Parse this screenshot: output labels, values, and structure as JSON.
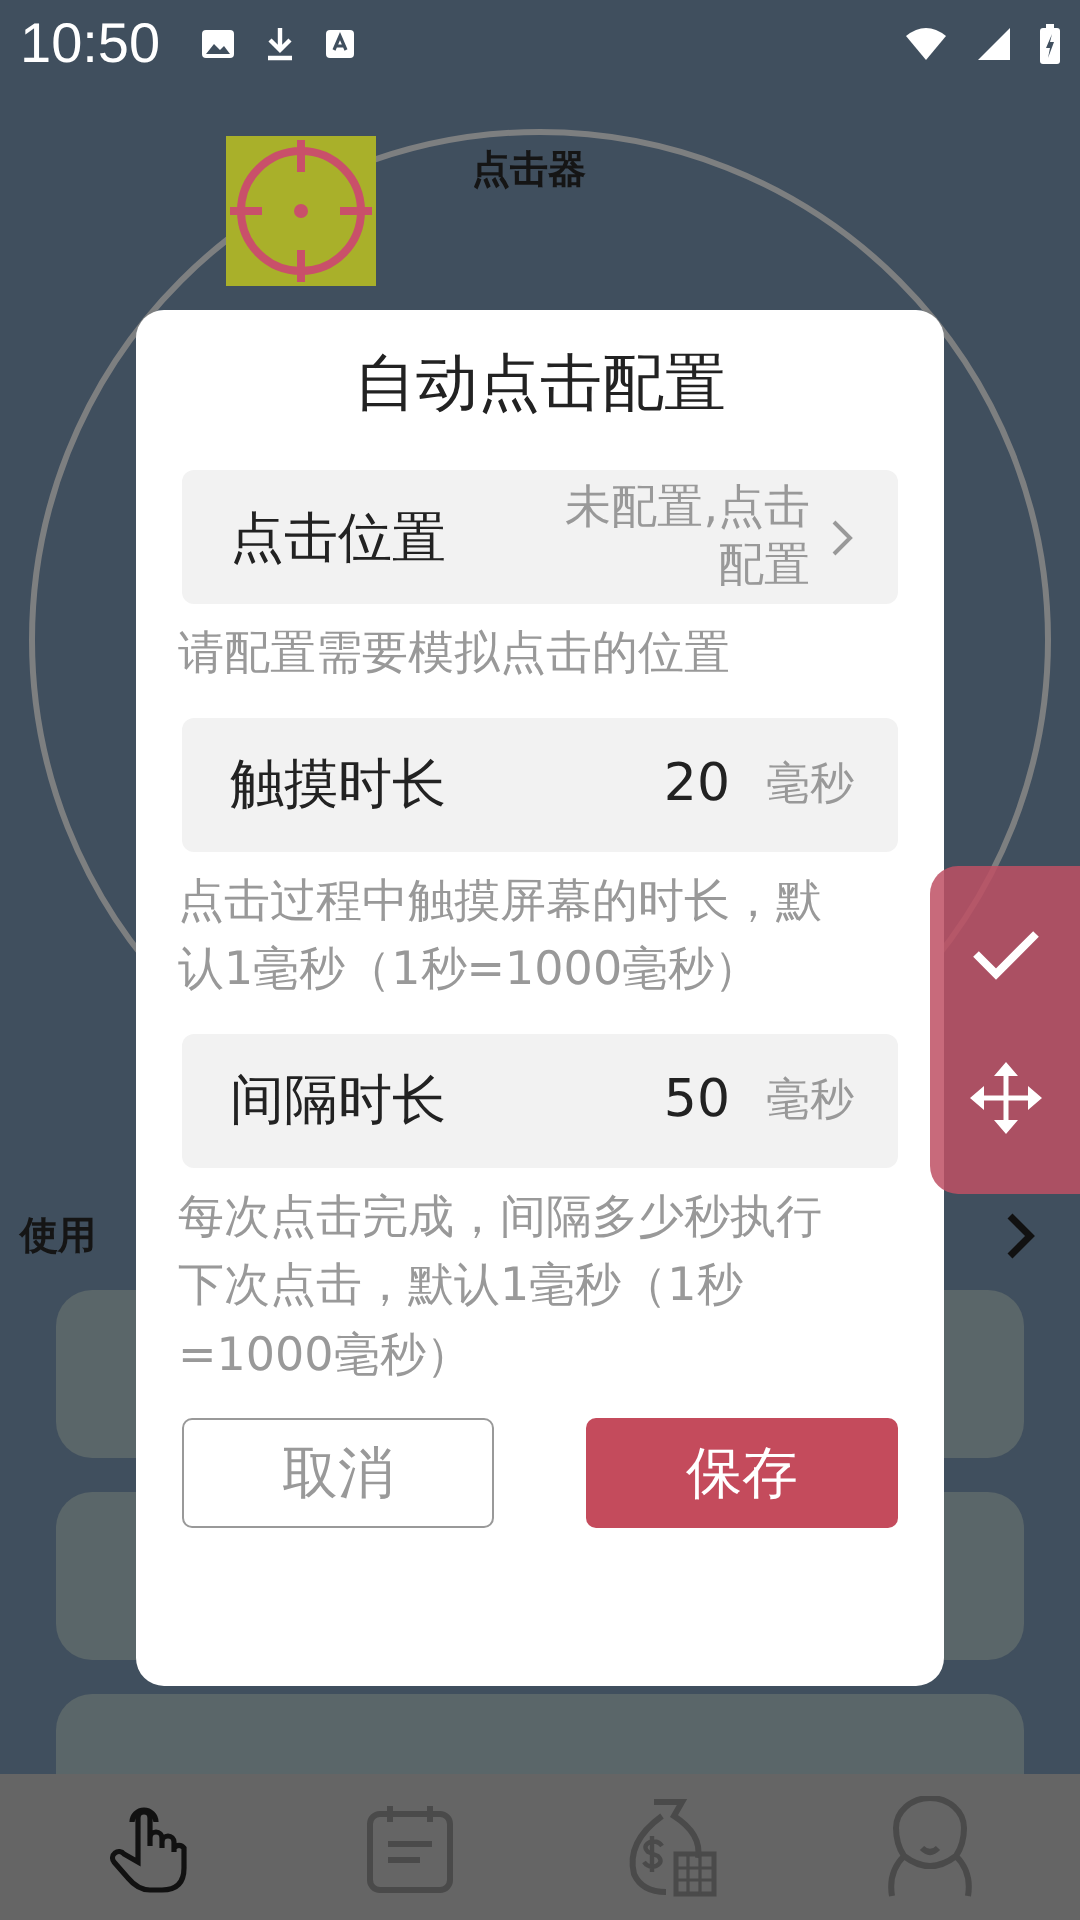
{
  "status_bar": {
    "time": "10:50"
  },
  "app": {
    "title": "点击器",
    "usage_label": "使用"
  },
  "bottom_nav": [
    {
      "selected": true
    },
    {
      "selected": false
    },
    {
      "selected": false
    },
    {
      "selected": false
    }
  ],
  "dialog": {
    "title": "自动点击配置",
    "fields": [
      {
        "kind": "link",
        "label": "点击位置",
        "value": "未配置,点击配置",
        "hint": "请配置需要模拟点击的位置"
      },
      {
        "kind": "number",
        "label": "触摸时长",
        "value": "20",
        "unit": "毫秒",
        "hint": "点击过程中触摸屏幕的时长，默认1毫秒（1秒=1000毫秒）"
      },
      {
        "kind": "number",
        "label": "间隔时长",
        "value": "50",
        "unit": "毫秒",
        "hint": "每次点击完成，间隔多少秒执行下次点击，默认1毫秒（1秒=1000毫秒）"
      }
    ],
    "buttons": [
      {
        "kind": "secondary",
        "label": "取消"
      },
      {
        "kind": "primary",
        "label": "保存"
      }
    ]
  }
}
